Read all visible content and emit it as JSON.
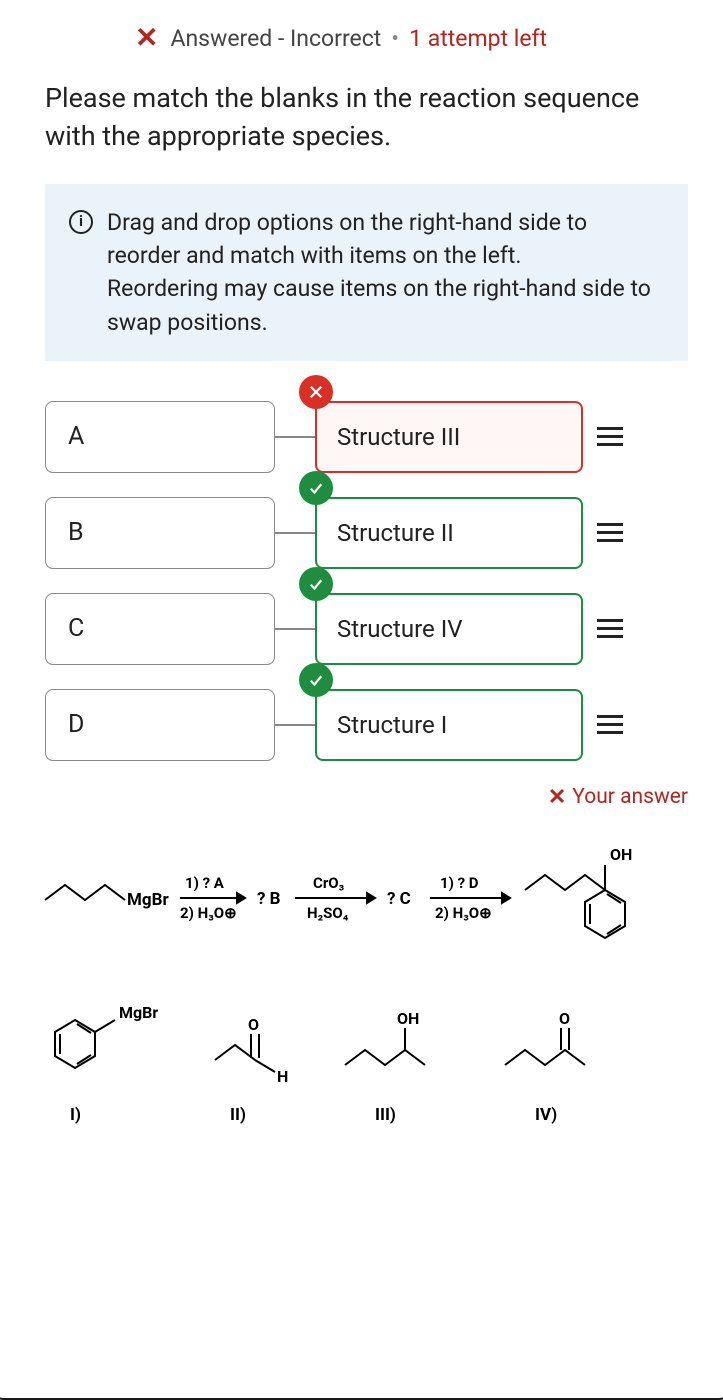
{
  "status": {
    "text": "Answered - Incorrect",
    "attempts": "1 attempt left"
  },
  "question": "Please match the blanks in the reaction sequence with the appropriate species.",
  "instructions": "Drag and drop options on the right-hand side to reorder and match with items on the left.\nReordering may cause items on the right-hand side to swap positions.",
  "rows": [
    {
      "left": "A",
      "right": "Structure III",
      "state": "incorrect"
    },
    {
      "left": "B",
      "right": "Structure II",
      "state": "correct"
    },
    {
      "left": "C",
      "right": "Structure IV",
      "state": "correct"
    },
    {
      "left": "D",
      "right": "Structure I",
      "state": "correct"
    }
  ],
  "your_answer_label": "Your answer",
  "reaction": {
    "start": "MgBr",
    "step1_top": "1) ? A",
    "step1_bot": "2) H₃O⊕",
    "b": "? B",
    "step2_top": "CrO₃",
    "step2_bot": "H₂SO₄",
    "c": "? C",
    "step3_top": "1) ? D",
    "step3_bot": "2) H₃O⊕",
    "product_oh": "OH"
  },
  "structures": {
    "i_label": "I)",
    "i_text": "MgBr",
    "ii_label": "II)",
    "ii_text": "H",
    "iii_label": "III)",
    "iii_text": "OH",
    "iv_label": "IV)"
  }
}
